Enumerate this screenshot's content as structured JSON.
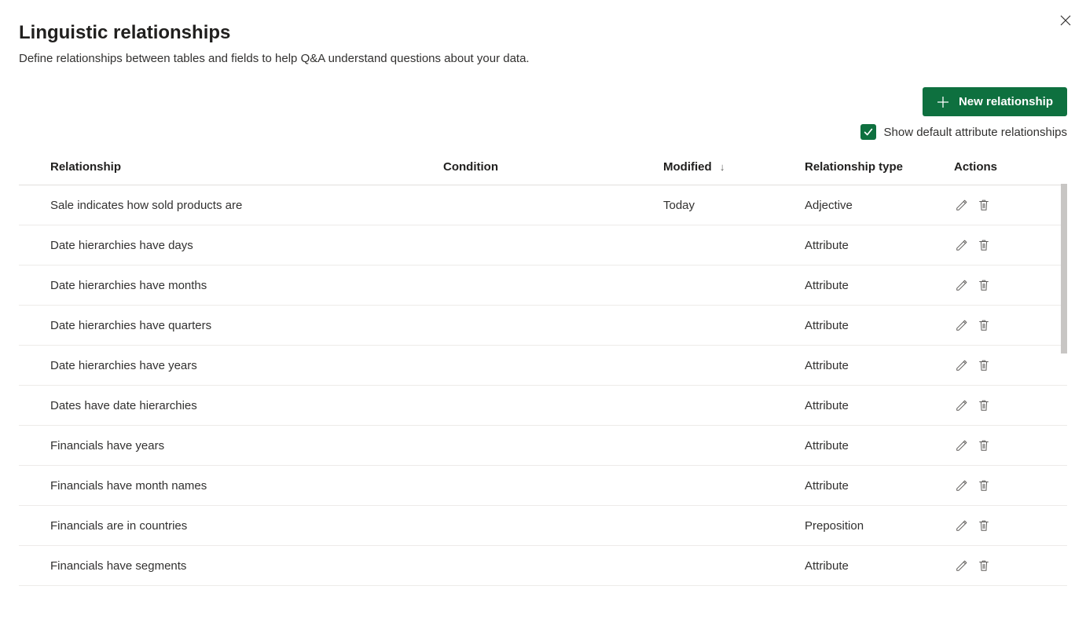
{
  "header": {
    "title": "Linguistic relationships",
    "subtitle": "Define relationships between tables and fields to help Q&A understand questions about your data."
  },
  "toolbar": {
    "new_relationship_label": "New relationship",
    "show_default_label": "Show default attribute relationships",
    "show_default_checked": true
  },
  "table": {
    "columns": {
      "relationship": "Relationship",
      "condition": "Condition",
      "modified": "Modified",
      "relationship_type": "Relationship type",
      "actions": "Actions"
    },
    "sort_column": "modified",
    "sort_direction": "desc",
    "rows": [
      {
        "relationship": "Sale indicates how sold products are",
        "condition": "",
        "modified": "Today",
        "type": "Adjective"
      },
      {
        "relationship": "Date hierarchies have days",
        "condition": "",
        "modified": "",
        "type": "Attribute"
      },
      {
        "relationship": "Date hierarchies have months",
        "condition": "",
        "modified": "",
        "type": "Attribute"
      },
      {
        "relationship": "Date hierarchies have quarters",
        "condition": "",
        "modified": "",
        "type": "Attribute"
      },
      {
        "relationship": "Date hierarchies have years",
        "condition": "",
        "modified": "",
        "type": "Attribute"
      },
      {
        "relationship": "Dates have date hierarchies",
        "condition": "",
        "modified": "",
        "type": "Attribute"
      },
      {
        "relationship": "Financials have years",
        "condition": "",
        "modified": "",
        "type": "Attribute"
      },
      {
        "relationship": "Financials have month names",
        "condition": "",
        "modified": "",
        "type": "Attribute"
      },
      {
        "relationship": "Financials are in countries",
        "condition": "",
        "modified": "",
        "type": "Preposition"
      },
      {
        "relationship": "Financials have segments",
        "condition": "",
        "modified": "",
        "type": "Attribute"
      }
    ]
  }
}
